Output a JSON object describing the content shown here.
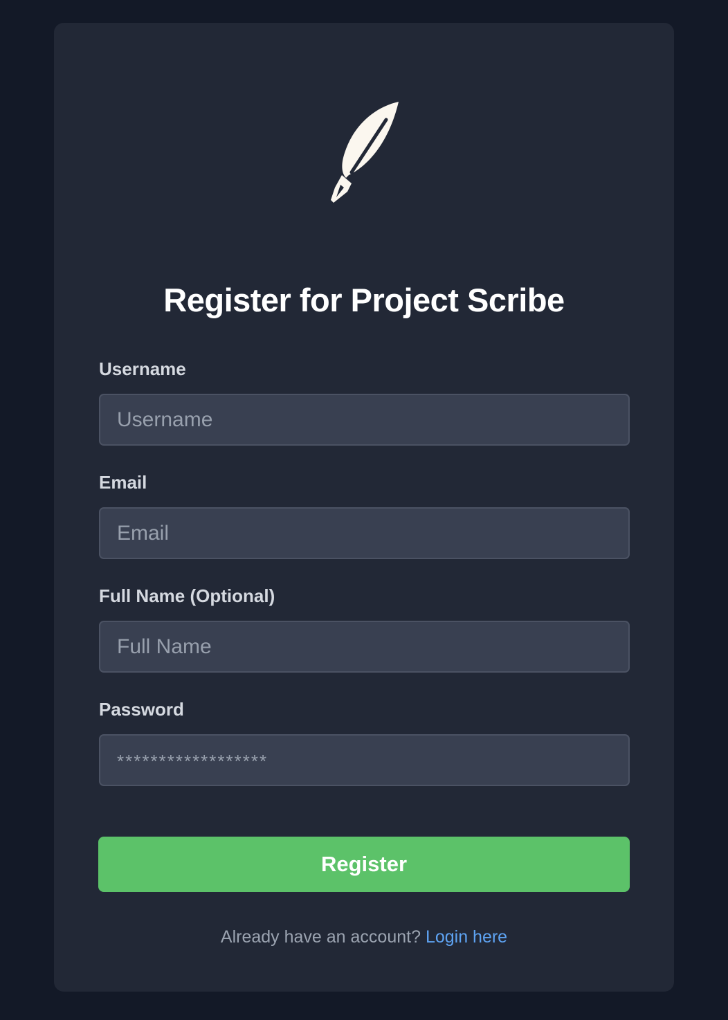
{
  "logo": {
    "icon": "feather-quill-icon",
    "color": "#fbf7ef"
  },
  "title": "Register for Project Scribe",
  "form": {
    "username": {
      "label": "Username",
      "placeholder": "Username"
    },
    "email": {
      "label": "Email",
      "placeholder": "Email"
    },
    "full_name": {
      "label": "Full Name (Optional)",
      "placeholder": "Full Name"
    },
    "password": {
      "label": "Password",
      "placeholder": "******************"
    },
    "submit_label": "Register"
  },
  "footer": {
    "prompt": "Already have an account?",
    "link_label": "Login here"
  },
  "colors": {
    "page_background": "#131927",
    "card_background": "#222836",
    "input_background": "#394051",
    "button": "#5cc269",
    "link": "#5ea3f2"
  }
}
